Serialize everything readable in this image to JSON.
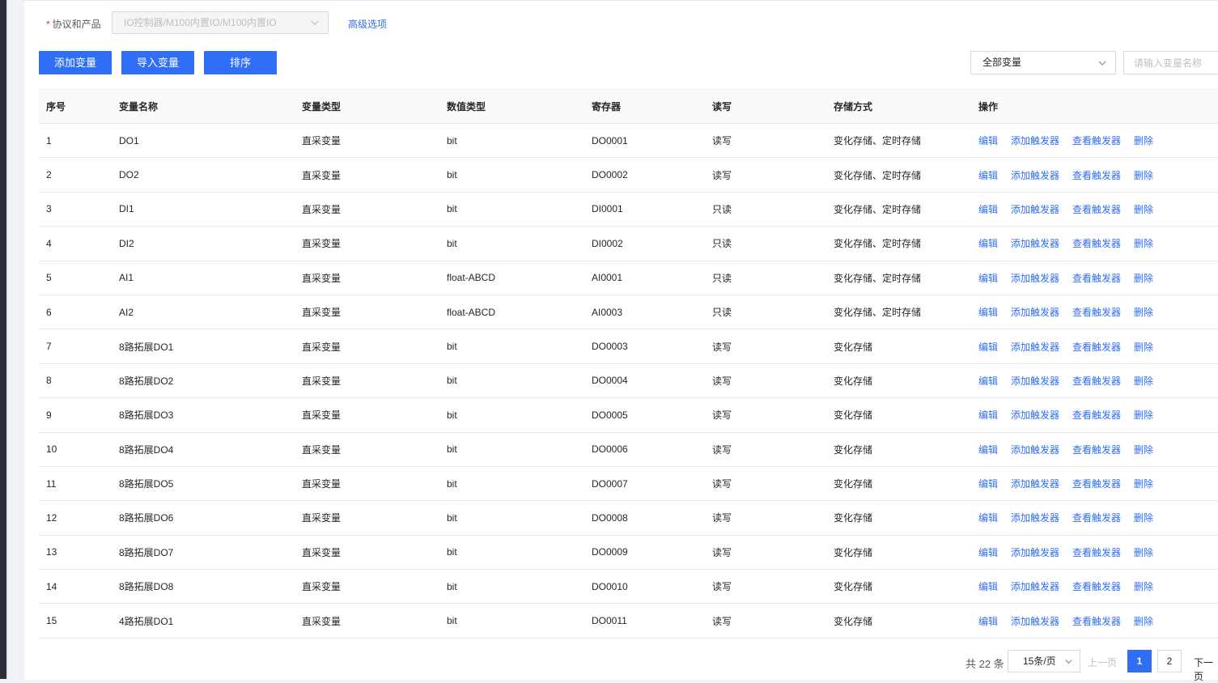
{
  "form": {
    "required_mark": "*",
    "protocol_label": "协议和产品",
    "protocol_value": "IO控制器/M100内置IO/M100内置IO",
    "advanced_link": "高级选项"
  },
  "toolbar": {
    "add_label": "添加变量",
    "import_label": "导入变量",
    "sort_label": "排序"
  },
  "filter": {
    "selected": "全部变量",
    "search_placeholder": "请输入变量名称"
  },
  "table": {
    "columns": [
      "序号",
      "变量名称",
      "变量类型",
      "数值类型",
      "寄存器",
      "读写",
      "存储方式",
      "操作"
    ],
    "actions": [
      "编辑",
      "添加触发器",
      "查看触发器",
      "删除"
    ],
    "rows": [
      [
        "1",
        "DO1",
        "直采变量",
        "bit",
        "DO0001",
        "读写",
        "变化存储、定时存储"
      ],
      [
        "2",
        "DO2",
        "直采变量",
        "bit",
        "DO0002",
        "读写",
        "变化存储、定时存储"
      ],
      [
        "3",
        "DI1",
        "直采变量",
        "bit",
        "DI0001",
        "只读",
        "变化存储、定时存储"
      ],
      [
        "4",
        "DI2",
        "直采变量",
        "bit",
        "DI0002",
        "只读",
        "变化存储、定时存储"
      ],
      [
        "5",
        "AI1",
        "直采变量",
        "float-ABCD",
        "AI0001",
        "只读",
        "变化存储、定时存储"
      ],
      [
        "6",
        "AI2",
        "直采变量",
        "float-ABCD",
        "AI0003",
        "只读",
        "变化存储、定时存储"
      ],
      [
        "7",
        "8路拓展DO1",
        "直采变量",
        "bit",
        "DO0003",
        "读写",
        "变化存储"
      ],
      [
        "8",
        "8路拓展DO2",
        "直采变量",
        "bit",
        "DO0004",
        "读写",
        "变化存储"
      ],
      [
        "9",
        "8路拓展DO3",
        "直采变量",
        "bit",
        "DO0005",
        "读写",
        "变化存储"
      ],
      [
        "10",
        "8路拓展DO4",
        "直采变量",
        "bit",
        "DO0006",
        "读写",
        "变化存储"
      ],
      [
        "11",
        "8路拓展DO5",
        "直采变量",
        "bit",
        "DO0007",
        "读写",
        "变化存储"
      ],
      [
        "12",
        "8路拓展DO6",
        "直采变量",
        "bit",
        "DO0008",
        "读写",
        "变化存储"
      ],
      [
        "13",
        "8路拓展DO7",
        "直采变量",
        "bit",
        "DO0009",
        "读写",
        "变化存储"
      ],
      [
        "14",
        "8路拓展DO8",
        "直采变量",
        "bit",
        "DO0010",
        "读写",
        "变化存储"
      ],
      [
        "15",
        "4路拓展DO1",
        "直采变量",
        "bit",
        "DO0011",
        "读写",
        "变化存储"
      ]
    ]
  },
  "pagination": {
    "total": "共 22 条",
    "page_size": "15条/页",
    "prev": "上一页",
    "pages": [
      "1",
      "2"
    ],
    "current": "1",
    "next": "下一页"
  },
  "colors": {
    "primary": "#2f6ef5",
    "required": "#f5222d",
    "header_bg": "#fafafa"
  }
}
